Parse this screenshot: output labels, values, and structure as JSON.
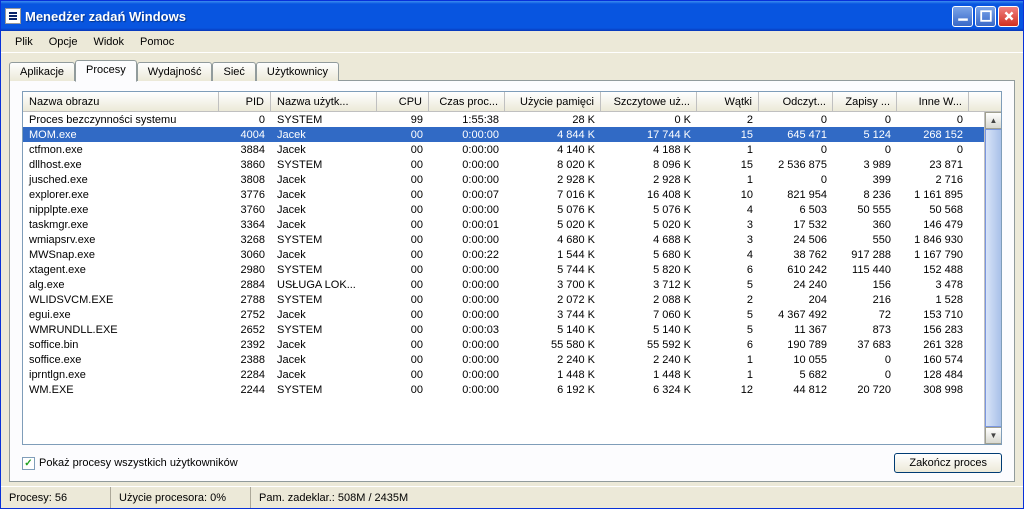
{
  "title": "Menedżer zadań Windows",
  "menus": [
    "Plik",
    "Opcje",
    "Widok",
    "Pomoc"
  ],
  "tabs": [
    "Aplikacje",
    "Procesy",
    "Wydajność",
    "Sieć",
    "Użytkownicy"
  ],
  "active_tab": 1,
  "columns": [
    {
      "label": "Nazwa obrazu",
      "align": "l"
    },
    {
      "label": "PID",
      "align": "r"
    },
    {
      "label": "Nazwa użytk...",
      "align": "l"
    },
    {
      "label": "CPU",
      "align": "r"
    },
    {
      "label": "Czas proc...",
      "align": "r"
    },
    {
      "label": "Użycie pamięci",
      "align": "r"
    },
    {
      "label": "Szczytowe uż...",
      "align": "r"
    },
    {
      "label": "Wątki",
      "align": "r"
    },
    {
      "label": "Odczyt...",
      "align": "r"
    },
    {
      "label": "Zapisy ...",
      "align": "r"
    },
    {
      "label": "Inne W...",
      "align": "r"
    }
  ],
  "selected_row": 1,
  "rows": [
    [
      "Proces bezczynności systemu",
      "0",
      "SYSTEM",
      "99",
      "1:55:38",
      "28 K",
      "0 K",
      "2",
      "0",
      "0",
      "0"
    ],
    [
      "MOM.exe",
      "4004",
      "Jacek",
      "00",
      "0:00:00",
      "4 844 K",
      "17 744 K",
      "15",
      "645 471",
      "5 124",
      "268 152"
    ],
    [
      "ctfmon.exe",
      "3884",
      "Jacek",
      "00",
      "0:00:00",
      "4 140 K",
      "4 188 K",
      "1",
      "0",
      "0",
      "0"
    ],
    [
      "dllhost.exe",
      "3860",
      "SYSTEM",
      "00",
      "0:00:00",
      "8 020 K",
      "8 096 K",
      "15",
      "2 536 875",
      "3 989",
      "23 871"
    ],
    [
      "jusched.exe",
      "3808",
      "Jacek",
      "00",
      "0:00:00",
      "2 928 K",
      "2 928 K",
      "1",
      "0",
      "399",
      "2 716"
    ],
    [
      "explorer.exe",
      "3776",
      "Jacek",
      "00",
      "0:00:07",
      "7 016 K",
      "16 408 K",
      "10",
      "821 954",
      "8 236",
      "1 161 895"
    ],
    [
      "nipplpte.exe",
      "3760",
      "Jacek",
      "00",
      "0:00:00",
      "5 076 K",
      "5 076 K",
      "4",
      "6 503",
      "50 555",
      "50 568"
    ],
    [
      "taskmgr.exe",
      "3364",
      "Jacek",
      "00",
      "0:00:01",
      "5 020 K",
      "5 020 K",
      "3",
      "17 532",
      "360",
      "146 479"
    ],
    [
      "wmiapsrv.exe",
      "3268",
      "SYSTEM",
      "00",
      "0:00:00",
      "4 680 K",
      "4 688 K",
      "3",
      "24 506",
      "550",
      "1 846 930"
    ],
    [
      "MWSnap.exe",
      "3060",
      "Jacek",
      "00",
      "0:00:22",
      "1 544 K",
      "5 680 K",
      "4",
      "38 762",
      "917 288",
      "1 167 790"
    ],
    [
      "xtagent.exe",
      "2980",
      "SYSTEM",
      "00",
      "0:00:00",
      "5 744 K",
      "5 820 K",
      "6",
      "610 242",
      "115 440",
      "152 488"
    ],
    [
      "alg.exe",
      "2884",
      "USŁUGA LOK...",
      "00",
      "0:00:00",
      "3 700 K",
      "3 712 K",
      "5",
      "24 240",
      "156",
      "3 478"
    ],
    [
      "WLIDSVCM.EXE",
      "2788",
      "SYSTEM",
      "00",
      "0:00:00",
      "2 072 K",
      "2 088 K",
      "2",
      "204",
      "216",
      "1 528"
    ],
    [
      "egui.exe",
      "2752",
      "Jacek",
      "00",
      "0:00:00",
      "3 744 K",
      "7 060 K",
      "5",
      "4 367 492",
      "72",
      "153 710"
    ],
    [
      "WMRUNDLL.EXE",
      "2652",
      "SYSTEM",
      "00",
      "0:00:03",
      "5 140 K",
      "5 140 K",
      "5",
      "11 367",
      "873",
      "156 283"
    ],
    [
      "soffice.bin",
      "2392",
      "Jacek",
      "00",
      "0:00:00",
      "55 580 K",
      "55 592 K",
      "6",
      "190 789",
      "37 683",
      "261 328"
    ],
    [
      "soffice.exe",
      "2388",
      "Jacek",
      "00",
      "0:00:00",
      "2 240 K",
      "2 240 K",
      "1",
      "10 055",
      "0",
      "160 574"
    ],
    [
      "iprntlgn.exe",
      "2284",
      "Jacek",
      "00",
      "0:00:00",
      "1 448 K",
      "1 448 K",
      "1",
      "5 682",
      "0",
      "128 484"
    ],
    [
      "WM.EXE",
      "2244",
      "SYSTEM",
      "00",
      "0:00:00",
      "6 192 K",
      "6 324 K",
      "12",
      "44 812",
      "20 720",
      "308 998"
    ]
  ],
  "show_all_users_label": "Pokaż procesy wszystkich użytkowników",
  "show_all_users_checked": true,
  "end_process_label": "Zakończ proces",
  "status": {
    "processes": "Procesy: 56",
    "cpu": "Użycie procesora: 0%",
    "mem": "Pam. zadeklar.: 508M / 2435M"
  }
}
